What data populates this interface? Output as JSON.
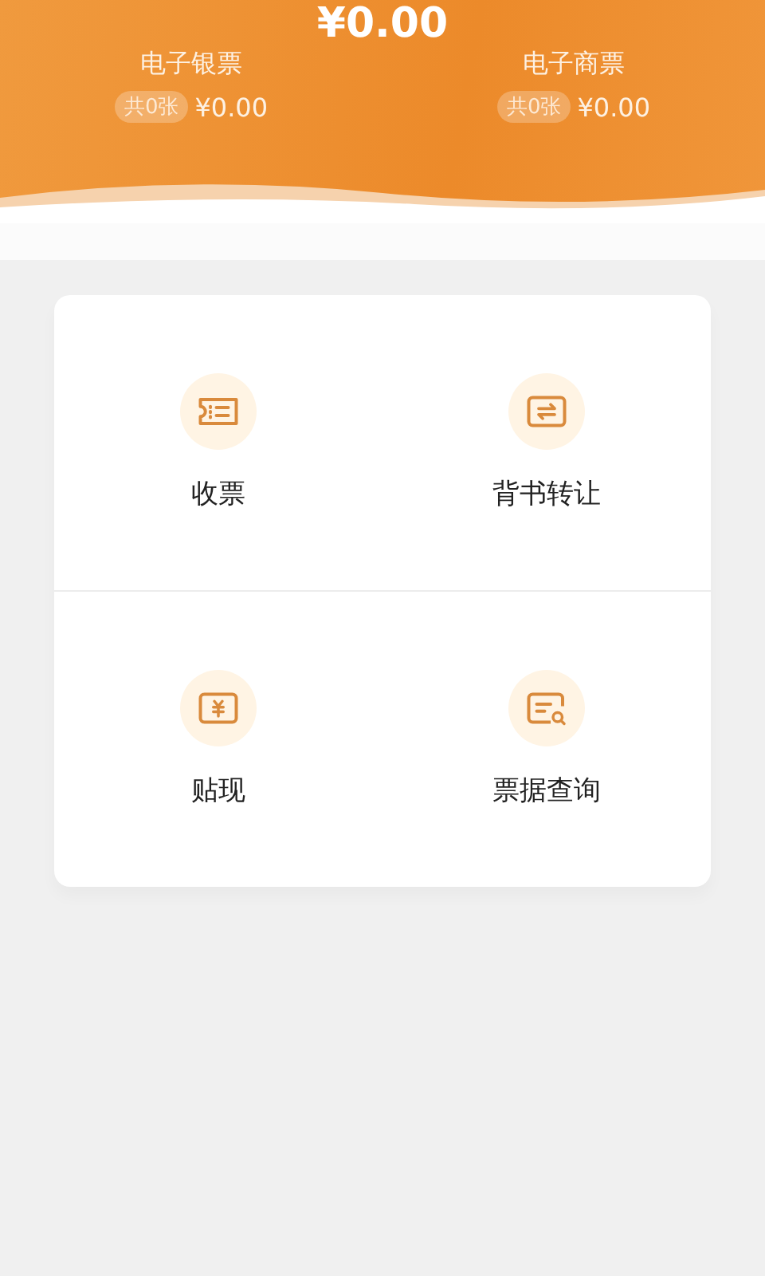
{
  "total": {
    "amount": "¥0.00"
  },
  "summaries": [
    {
      "label": "电子银票",
      "count": "共0张",
      "amount": "¥0.00"
    },
    {
      "label": "电子商票",
      "count": "共0张",
      "amount": "¥0.00"
    }
  ],
  "actions": [
    {
      "kind": "receive",
      "label": "收票"
    },
    {
      "kind": "transfer",
      "label": "背书转让"
    },
    {
      "kind": "discount",
      "label": "贴现"
    },
    {
      "kind": "query",
      "label": "票据查询"
    }
  ]
}
